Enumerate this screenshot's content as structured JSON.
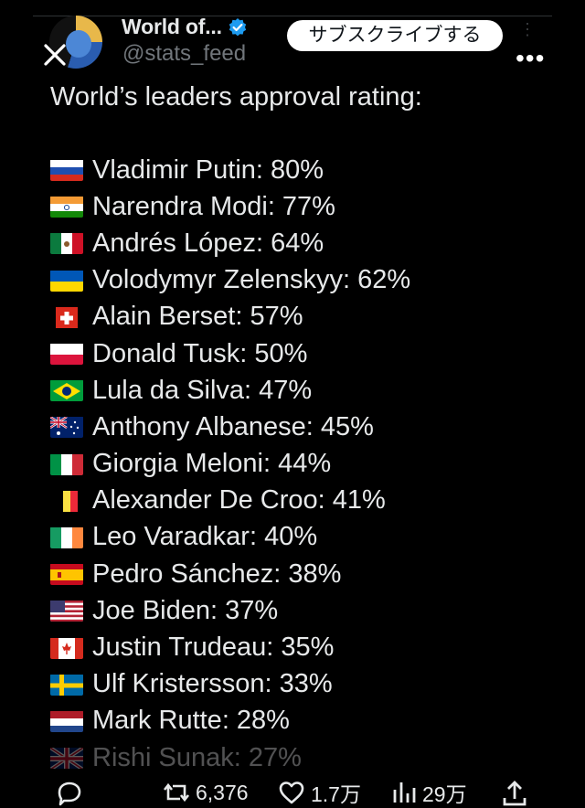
{
  "account": {
    "name": "World of...",
    "handle": "@stats_feed",
    "subscribe_label": "サブスクライブする"
  },
  "tweet": {
    "headline": "World’s leaders approval rating:",
    "leaders": [
      {
        "flag": "russia",
        "text": "Vladimir Putin: 80%"
      },
      {
        "flag": "india",
        "text": "Narendra Modi: 77%"
      },
      {
        "flag": "mexico",
        "text": "Andrés López: 64%"
      },
      {
        "flag": "ukraine",
        "text": "Volodymyr Zelenskyy: 62%"
      },
      {
        "flag": "switzerland",
        "text": "Alain Berset: 57%"
      },
      {
        "flag": "poland",
        "text": "Donald Tusk: 50%"
      },
      {
        "flag": "brazil",
        "text": "Lula da Silva: 47%"
      },
      {
        "flag": "australia",
        "text": "Anthony Albanese: 45%"
      },
      {
        "flag": "italy",
        "text": "Giorgia Meloni: 44%"
      },
      {
        "flag": "belgium",
        "text": "Alexander De Croo: 41%"
      },
      {
        "flag": "ireland",
        "text": "Leo Varadkar: 40%"
      },
      {
        "flag": "spain",
        "text": "Pedro Sánchez: 38%"
      },
      {
        "flag": "usa",
        "text": "Joe Biden: 37%"
      },
      {
        "flag": "canada",
        "text": "Justin Trudeau: 35%"
      },
      {
        "flag": "sweden",
        "text": "Ulf Kristersson: 33%"
      },
      {
        "flag": "netherlands",
        "text": "Mark Rutte: 28%"
      },
      {
        "flag": "uk",
        "text": "Rishi Sunak: 27%"
      }
    ]
  },
  "actions": {
    "reply_icon": "speech-bubble-icon",
    "retweet_count": "6,376",
    "like_count": "1.7万",
    "views_count": "29万",
    "share_icon": "share-icon"
  },
  "colors": {
    "background": "#000000",
    "text": "#e7e9ea",
    "muted": "#71767b",
    "verified": "#1d9bf0"
  }
}
